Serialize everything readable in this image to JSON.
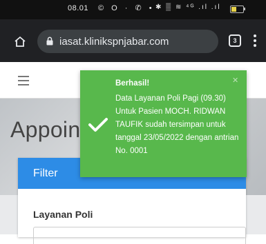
{
  "status_bar": {
    "time": "08.01",
    "left_icons": "© O · ✆ •",
    "right_icons": "✱ ▒ ≋ ⁴ᴳ .ıl .ıl"
  },
  "browser": {
    "url": "iasat.klinikspnjabar.com",
    "tab_count": "3"
  },
  "page": {
    "title": "Appointment",
    "filter_header": "Filter",
    "field_label": "Layanan Poli"
  },
  "toast": {
    "title": "Berhasil!",
    "close": "✕",
    "message": "Data Layanan Poli Pagi (09.30) Untuk Pasien MOCH. RIDWAN TAUFIK sudah tersimpan untuk tanggal 23/05/2022 dengan antrian No. 0001"
  },
  "colors": {
    "toast_bg": "#58b84c",
    "filter_header_bg": "#2d8ce6",
    "browser_bar_bg": "#202124"
  }
}
